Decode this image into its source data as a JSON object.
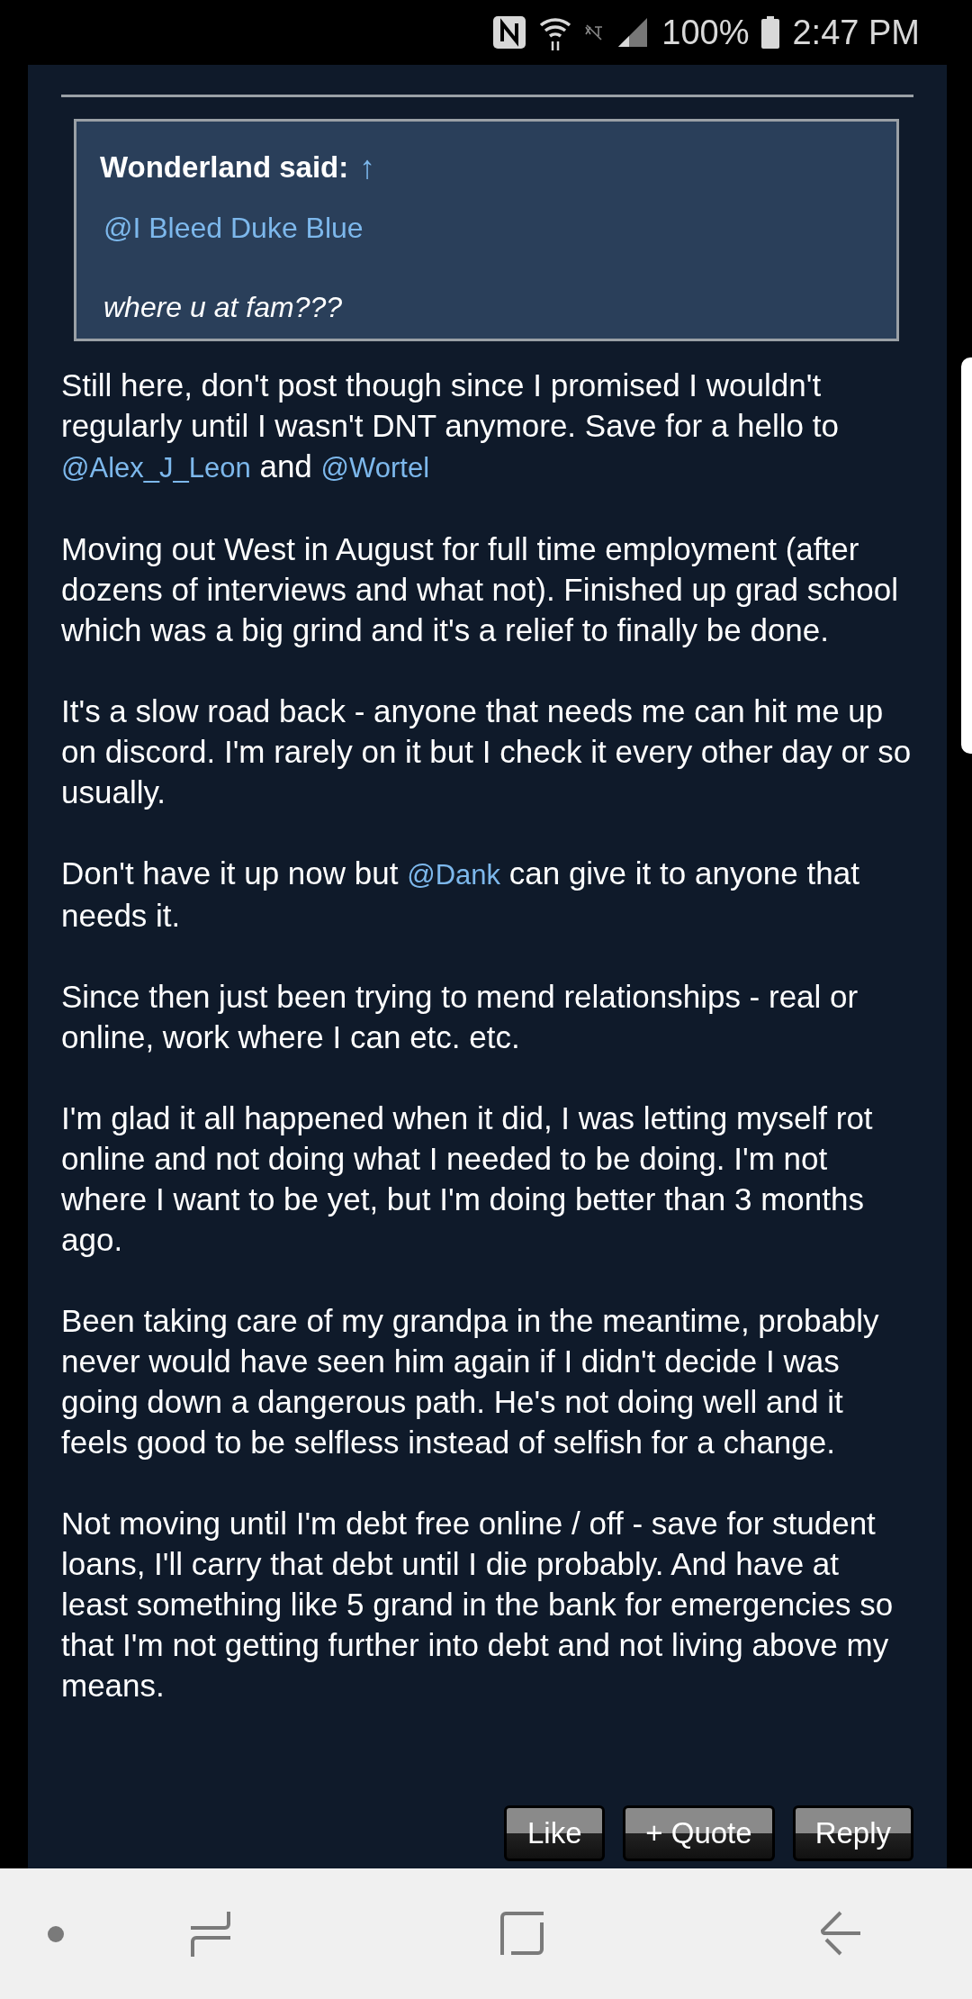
{
  "status_bar": {
    "battery": "100%",
    "time": "2:47 PM"
  },
  "quote": {
    "author": "Wonderland said:",
    "arrow": "↑",
    "mention": "@I Bleed Duke Blue",
    "text": "where u at fam???"
  },
  "paragraphs": [
    [
      {
        "kind": "text",
        "text": "Still here, don't post though since I promised I wouldn't regularly until I wasn't DNT anymore. Save for a hello to "
      },
      {
        "kind": "mention",
        "text": "@Alex_J_Leon"
      },
      {
        "kind": "text",
        "text": " and "
      },
      {
        "kind": "mention",
        "text": "@Wortel"
      }
    ],
    [
      {
        "kind": "text",
        "text": "Moving out West in August for full time employment (after dozens of interviews and what not). Finished up grad school which was a big grind and it's a relief to finally be done."
      }
    ],
    [
      {
        "kind": "text",
        "text": "It's a slow road back - anyone that needs me can hit me up on discord. I'm rarely on it but I check it every other day or so usually."
      }
    ],
    [
      {
        "kind": "text",
        "text": "Don't have it up now but "
      },
      {
        "kind": "mention",
        "text": "@Dank"
      },
      {
        "kind": "text",
        "text": " can give it to anyone that needs it."
      }
    ],
    [
      {
        "kind": "text",
        "text": "Since then just been trying to mend relationships - real or online, work where I can etc. etc."
      }
    ],
    [
      {
        "kind": "text",
        "text": "I'm glad it all happened when it did, I was letting myself rot online and not doing what I needed to be doing. I'm not where I want to be yet, but I'm doing better than 3 months ago."
      }
    ],
    [
      {
        "kind": "text",
        "text": "Been taking care of my grandpa in the meantime, probably never would have seen him again if I didn't decide I was going down a dangerous path. He's not doing well and it feels good to be selfless instead of selfish for a change."
      }
    ],
    [
      {
        "kind": "text",
        "text": "Not moving until I'm debt free online / off - save for student loans, I'll carry that debt until I die probably. And have at least something like 5 grand in the bank for emergencies so that I'm not getting further into debt and not living above my means."
      }
    ]
  ],
  "buttons": [
    "Like",
    "+ Quote",
    "Reply"
  ]
}
